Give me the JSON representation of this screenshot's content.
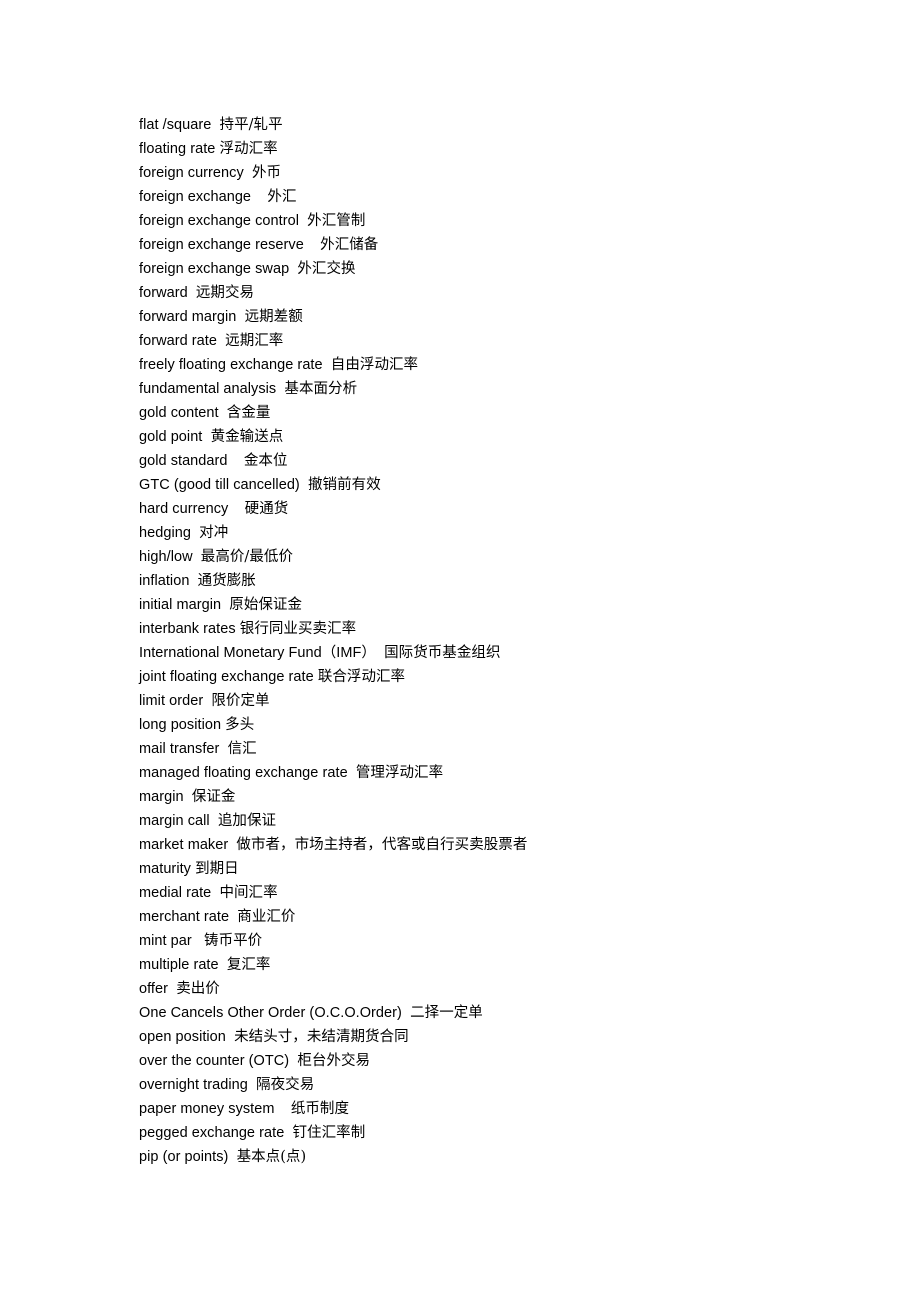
{
  "document": {
    "type": "glossary-page",
    "background_color": "#ffffff",
    "text_color": "#000000",
    "entries": [
      {
        "term": "flat /square",
        "gap": "  ",
        "gloss": "持平/轧平"
      },
      {
        "term": "floating rate",
        "gap": " ",
        "gloss": "浮动汇率"
      },
      {
        "term": "foreign currency",
        "gap": "  ",
        "gloss": "外币"
      },
      {
        "term": "foreign exchange",
        "gap": "    ",
        "gloss": "外汇"
      },
      {
        "term": "foreign exchange control",
        "gap": "  ",
        "gloss": "外汇管制"
      },
      {
        "term": "foreign exchange reserve",
        "gap": "    ",
        "gloss": "外汇储备"
      },
      {
        "term": "foreign exchange swap",
        "gap": "  ",
        "gloss": "外汇交换"
      },
      {
        "term": "forward",
        "gap": "  ",
        "gloss": "远期交易"
      },
      {
        "term": "forward margin",
        "gap": "  ",
        "gloss": "远期差额"
      },
      {
        "term": "forward rate",
        "gap": "  ",
        "gloss": "远期汇率"
      },
      {
        "term": "freely floating exchange rate",
        "gap": "  ",
        "gloss": "自由浮动汇率"
      },
      {
        "term": "fundamental analysis",
        "gap": "  ",
        "gloss": "基本面分析"
      },
      {
        "term": "gold content",
        "gap": "  ",
        "gloss": "含金量"
      },
      {
        "term": "gold point",
        "gap": "  ",
        "gloss": "黄金输送点"
      },
      {
        "term": "gold standard",
        "gap": "    ",
        "gloss": "金本位"
      },
      {
        "term": "GTC (good till cancelled)",
        "gap": "  ",
        "gloss": "撤销前有效"
      },
      {
        "term": "hard currency",
        "gap": "    ",
        "gloss": "硬通货"
      },
      {
        "term": "hedging",
        "gap": "  ",
        "gloss": "对冲"
      },
      {
        "term": "high/low",
        "gap": "  ",
        "gloss": "最高价/最低价"
      },
      {
        "term": "inflation",
        "gap": "  ",
        "gloss": "通货膨胀"
      },
      {
        "term": "initial margin",
        "gap": "  ",
        "gloss": "原始保证金"
      },
      {
        "term": "interbank rates",
        "gap": " ",
        "gloss": "银行同业买卖汇率"
      },
      {
        "term": "International Monetary Fund（IMF）",
        "gap": "  ",
        "gloss": "国际货币基金组织"
      },
      {
        "term": "joint floating exchange rate",
        "gap": " ",
        "gloss": "联合浮动汇率"
      },
      {
        "term": "limit order",
        "gap": "  ",
        "gloss": "限价定单"
      },
      {
        "term": "long position",
        "gap": " ",
        "gloss": "多头"
      },
      {
        "term": "mail transfer",
        "gap": "  ",
        "gloss": "信汇"
      },
      {
        "term": "managed floating exchange rate",
        "gap": "  ",
        "gloss": "管理浮动汇率"
      },
      {
        "term": "margin",
        "gap": "  ",
        "gloss": "保证金"
      },
      {
        "term": "margin call",
        "gap": "  ",
        "gloss": "追加保证"
      },
      {
        "term": "market maker",
        "gap": "  ",
        "gloss": "做市者，市场主持者，代客或自行买卖股票者"
      },
      {
        "term": "maturity",
        "gap": " ",
        "gloss": "到期日"
      },
      {
        "term": "medial rate",
        "gap": "  ",
        "gloss": "中间汇率"
      },
      {
        "term": "merchant rate",
        "gap": "  ",
        "gloss": "商业汇价"
      },
      {
        "term": "mint par",
        "gap": "   ",
        "gloss": "铸币平价"
      },
      {
        "term": "multiple rate",
        "gap": "  ",
        "gloss": "复汇率"
      },
      {
        "term": "offer",
        "gap": "  ",
        "gloss": "卖出价"
      },
      {
        "term": "One Cancels Other Order (O.C.O.Order)",
        "gap": "  ",
        "gloss": "二择一定单"
      },
      {
        "term": "open position",
        "gap": "  ",
        "gloss": "未结头寸，未结清期货合同"
      },
      {
        "term": "over the counter (OTC)",
        "gap": "  ",
        "gloss": "柜台外交易"
      },
      {
        "term": "overnight trading",
        "gap": "  ",
        "gloss": "隔夜交易"
      },
      {
        "term": "paper money system",
        "gap": "    ",
        "gloss": "纸币制度"
      },
      {
        "term": "pegged exchange rate",
        "gap": "  ",
        "gloss": "钉住汇率制"
      },
      {
        "term": "pip (or points)",
        "gap": "  ",
        "gloss": "基本点(点)"
      }
    ]
  }
}
